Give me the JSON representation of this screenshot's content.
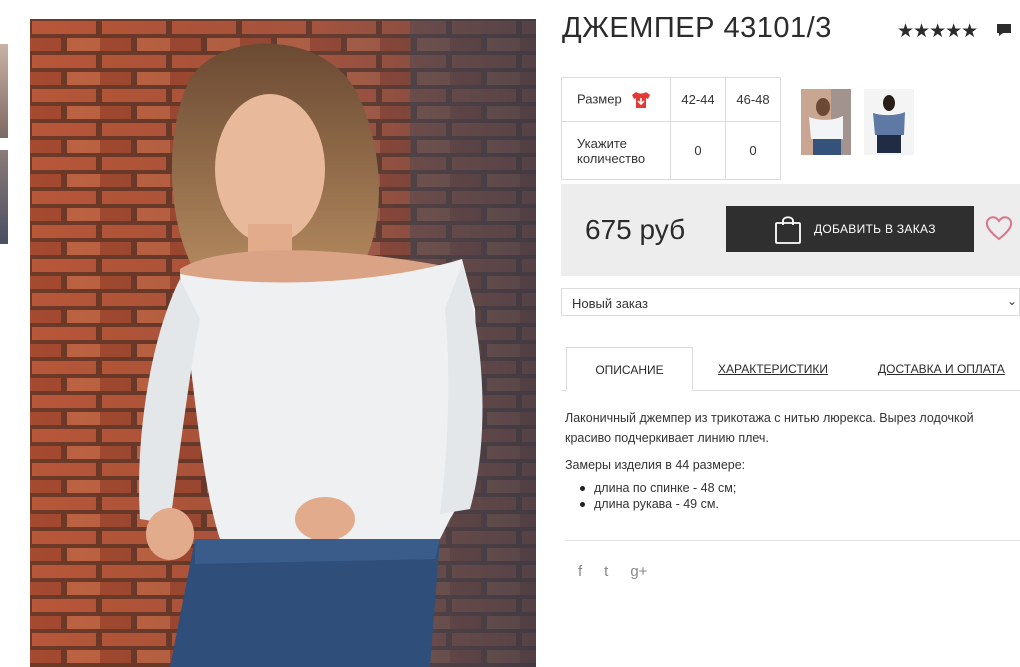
{
  "product": {
    "title": "ДЖЕМПЕР 43101/3",
    "rating_stars": "★★★★★",
    "rating_value": 5,
    "price": "675 руб"
  },
  "size_table": {
    "size_label": "Размер",
    "sizes": [
      "42-44",
      "46-48"
    ],
    "quantity_label_line1": "Укажите",
    "quantity_label_line2": "количество",
    "quantities": [
      "0",
      "0"
    ]
  },
  "cart": {
    "add_button_label": "ДОБАВИТЬ В ЗАКАЗ"
  },
  "order_select": {
    "selected": "Новый заказ"
  },
  "tabs": [
    {
      "label": "ОПИСАНИЕ"
    },
    {
      "label": "ХАРАКТЕРИСТИКИ"
    },
    {
      "label": "ДОСТАВКА И ОПЛАТА"
    }
  ],
  "description": {
    "text": "Лаконичный джемпер из трикотажа с нитью люрекса. Вырез лодочкой красиво подчеркивает линию плеч.",
    "measure_title": "Замеры изделия в 44 размере:",
    "bullets": [
      "длина по спинке - 48 см;",
      "длина рукава - 49 см."
    ]
  },
  "social": {
    "facebook": "f",
    "twitter": "t",
    "googleplus": "g+"
  },
  "colors": {
    "accent": "#e53935",
    "button_bg": "#2f2f2f",
    "heart": "#d9778a",
    "price_box_bg": "#ededed"
  },
  "icons": [
    "star-icon",
    "comment-icon",
    "size-chart-icon",
    "bag-icon",
    "heart-icon",
    "facebook-icon",
    "twitter-icon",
    "googleplus-icon",
    "chevron-down-icon"
  ]
}
